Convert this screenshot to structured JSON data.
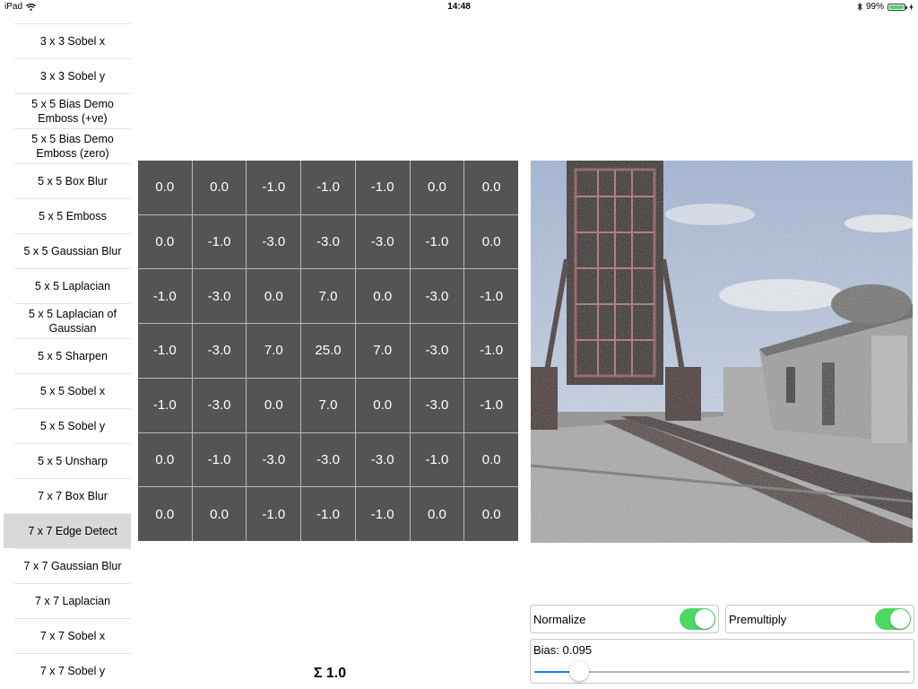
{
  "status": {
    "device": "iPad",
    "time": "14:48",
    "battery_percent": "99%",
    "battery_level": 0.99
  },
  "sidebar": {
    "items": [
      {
        "label": "3 x 3 Sobel x"
      },
      {
        "label": "3 x 3 Sobel y"
      },
      {
        "label": "5 x 5 Bias Demo Emboss (+ve)"
      },
      {
        "label": "5 x 5 Bias Demo Emboss (zero)"
      },
      {
        "label": "5 x 5 Box Blur"
      },
      {
        "label": "5 x 5 Emboss"
      },
      {
        "label": "5 x 5 Gaussian Blur"
      },
      {
        "label": "5 x 5 Laplacian"
      },
      {
        "label": "5 x 5 Laplacian of Gaussian"
      },
      {
        "label": "5 x 5 Sharpen"
      },
      {
        "label": "5 x 5 Sobel x"
      },
      {
        "label": "5 x 5 Sobel y"
      },
      {
        "label": "5 x 5 Unsharp"
      },
      {
        "label": "7 x 7 Box Blur"
      },
      {
        "label": "7 x 7 Edge Detect",
        "selected": true
      },
      {
        "label": "7 x 7 Gaussian Blur"
      },
      {
        "label": "7 x 7 Laplacian"
      },
      {
        "label": "7 x 7 Sobel x"
      },
      {
        "label": "7 x 7 Sobel y"
      }
    ]
  },
  "kernel": {
    "rows": [
      [
        "0.0",
        "0.0",
        "-1.0",
        "-1.0",
        "-1.0",
        "0.0",
        "0.0"
      ],
      [
        "0.0",
        "-1.0",
        "-3.0",
        "-3.0",
        "-3.0",
        "-1.0",
        "0.0"
      ],
      [
        "-1.0",
        "-3.0",
        "0.0",
        "7.0",
        "0.0",
        "-3.0",
        "-1.0"
      ],
      [
        "-1.0",
        "-3.0",
        "7.0",
        "25.0",
        "7.0",
        "-3.0",
        "-1.0"
      ],
      [
        "-1.0",
        "-3.0",
        "0.0",
        "7.0",
        "0.0",
        "-3.0",
        "-1.0"
      ],
      [
        "0.0",
        "-1.0",
        "-3.0",
        "-3.0",
        "-3.0",
        "-1.0",
        "0.0"
      ],
      [
        "0.0",
        "0.0",
        "-1.0",
        "-1.0",
        "-1.0",
        "0.0",
        "0.0"
      ]
    ],
    "sum_label": "Σ 1.0"
  },
  "controls": {
    "normalize": {
      "label": "Normalize",
      "on": true
    },
    "premultiply": {
      "label": "Premultiply",
      "on": true
    },
    "bias": {
      "label": "Bias: 0.095",
      "value": 0.095,
      "slider_fraction": 0.12
    }
  },
  "colors": {
    "switch_on": "#4cd964",
    "cell_bg": "#545454",
    "selected_row": "#d9d9d9",
    "slider_accent": "#1a7cf5"
  }
}
